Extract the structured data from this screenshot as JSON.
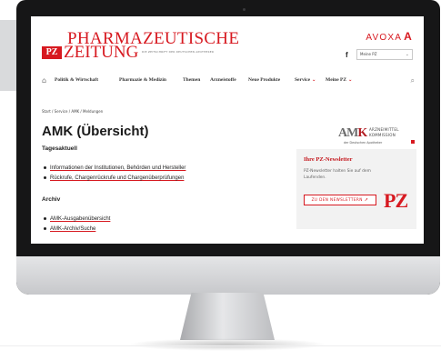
{
  "header": {
    "logo_line1": "PHARMAZEUTISCHE",
    "logo_box": "PZ",
    "logo_line2": "ZEITUNG",
    "logo_tagline": "DIE ZEITSCHRIFT DER DEUTSCHEN APOTHEKER",
    "publisher": "AVOXA",
    "publisher_mark": "A",
    "facebook_icon": "f",
    "account_select": "Meine PZ"
  },
  "nav": {
    "items": [
      {
        "label": "Politik & Wirtschaft"
      },
      {
        "label": "Pharmazie & Medizin"
      },
      {
        "label": "Themen"
      },
      {
        "label": "Arzneistoffe"
      },
      {
        "label": "Neue Produkte"
      },
      {
        "label": "Service"
      },
      {
        "label": "Meine PZ"
      }
    ]
  },
  "breadcrumb": "Start / Service / AMK / Meldungen",
  "main": {
    "title": "AMK (Übersicht)",
    "section1": "Tagesaktuell",
    "links1": [
      "Informationen der Institutionen, Behörden und Hersteller",
      "Rückrufe, Chargenrückrufe und Chargenüberprüfungen"
    ],
    "section2": "Archiv",
    "links2": [
      "AMK-Ausgabenübersicht",
      "AMK-Archiv/Suche"
    ]
  },
  "amk_logo": {
    "mark": "AM",
    "mark_k": "K",
    "line1": "ARZNEIMITTEL",
    "line2": "KOMMISSION",
    "line3": "der Deutschen Apotheker"
  },
  "newsletter": {
    "title": "Ihre PZ-Newsletter",
    "text": "PZ-Newsletter halten Sie auf dem Laufenden.",
    "button": "ZU DEN NEWSLETTERN",
    "logo": "PZ"
  },
  "colors": {
    "brand_red": "#d71920",
    "bezel": "#161617"
  }
}
